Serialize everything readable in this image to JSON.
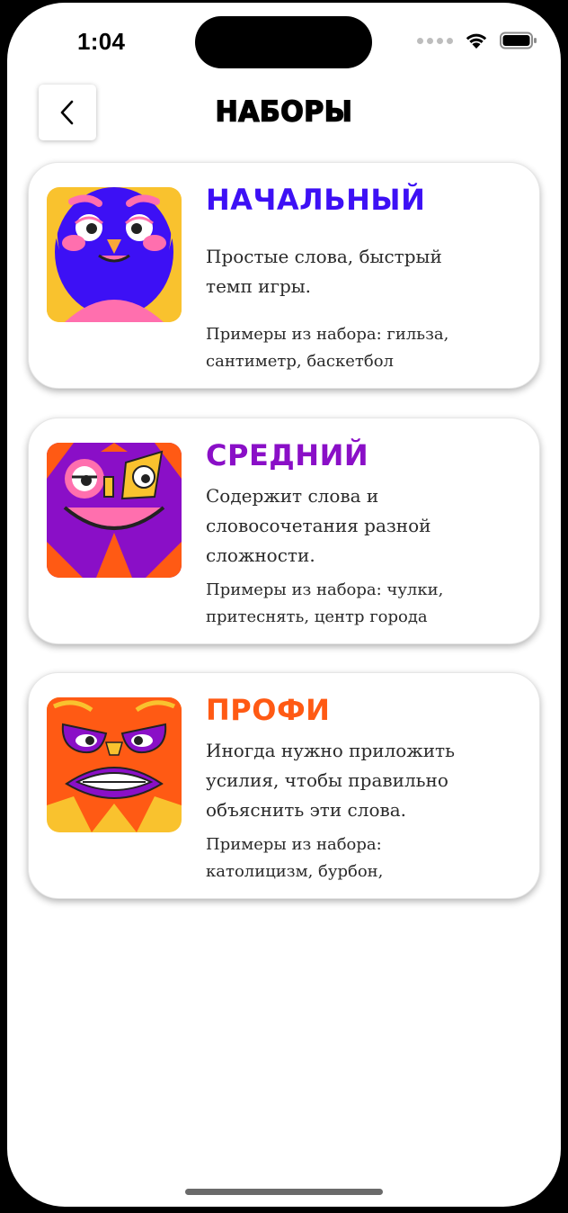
{
  "status_bar": {
    "time": "1:04"
  },
  "header": {
    "title": "НАБОРЫ"
  },
  "sets": [
    {
      "title": "НАЧАЛЬНЫЙ",
      "color": "#3d10f5",
      "description": "Простые слова, быстрый темп игры.",
      "examples": "Примеры из набора: гильза, сантиметр, баскетбол"
    },
    {
      "title": "СРЕДНИЙ",
      "color": "#8a0fc7",
      "description": "Содержит слова и словосочетания разной сложности.",
      "examples": "Примеры из набора: чулки, притеснять, центр города"
    },
    {
      "title": "ПРОФИ",
      "color": "#ff5a14",
      "description": "Иногда нужно приложить усилия, чтобы правильно объяснить эти слова.",
      "examples": "Примеры из набора: католицизм, бурбон,"
    }
  ]
}
